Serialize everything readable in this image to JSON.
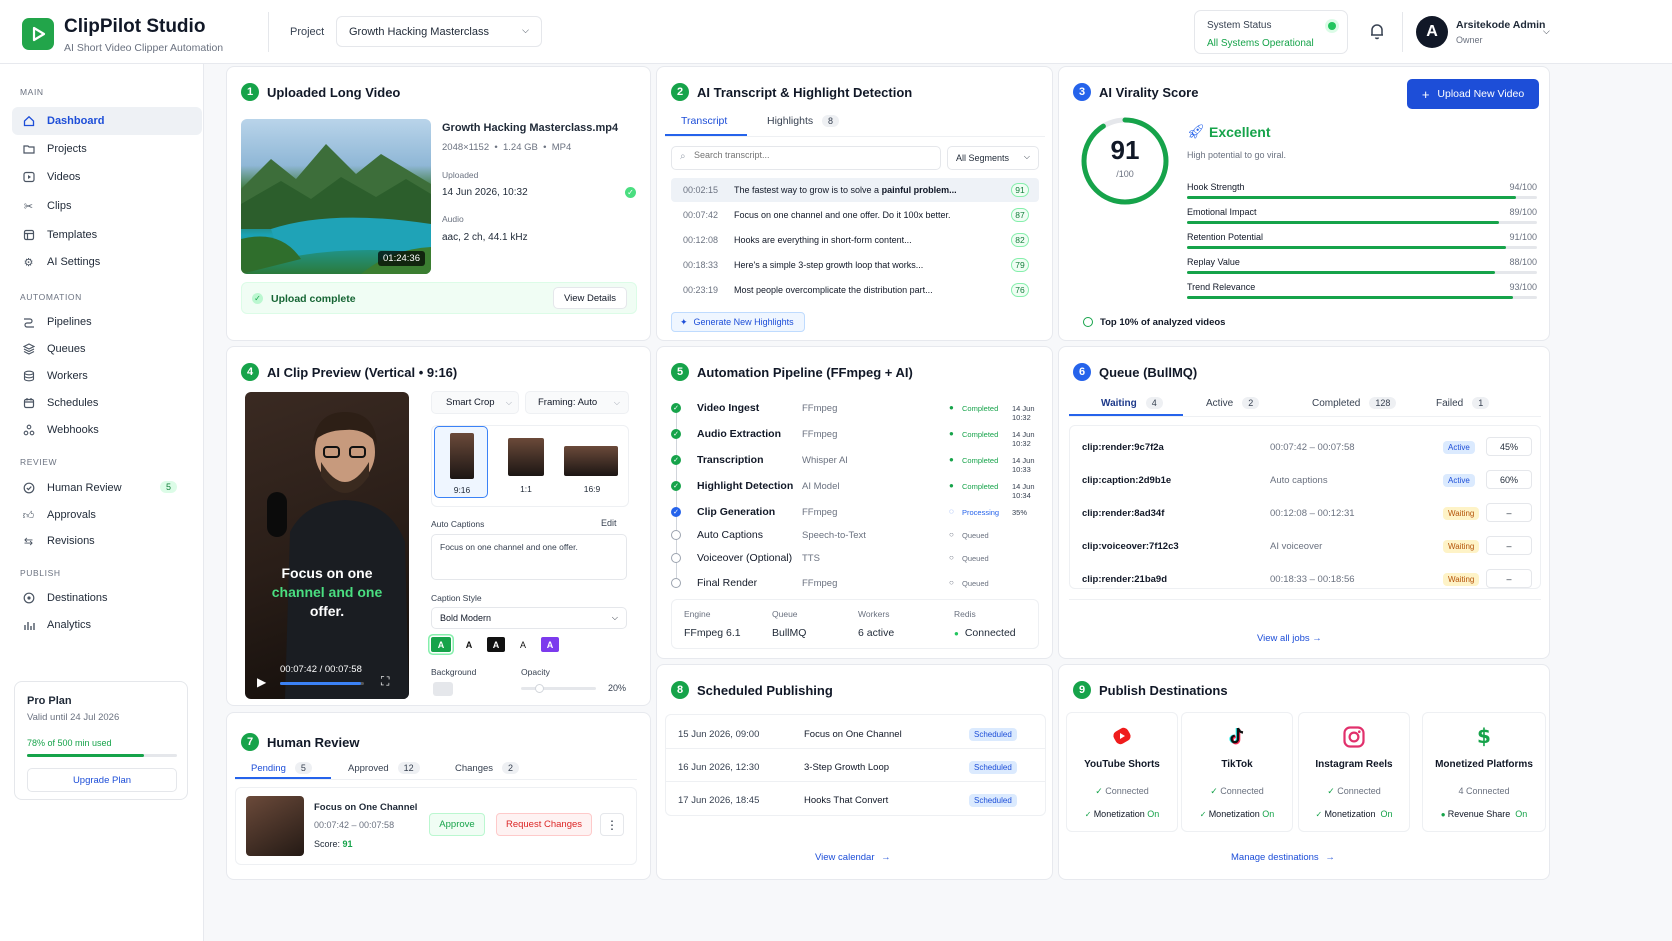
{
  "app": {
    "name": "ClipPilot Studio",
    "subtitle": "AI Short Video Clipper Automation"
  },
  "header": {
    "project_label": "Project",
    "project_value": "Growth Hacking Masterclass",
    "status_title": "System Status",
    "status_value": "All Systems Operational",
    "user_name": "Arsitekode Admin",
    "user_role": "Owner",
    "avatar_letter": "A"
  },
  "sidebar": {
    "sections": {
      "main": "MAIN",
      "automation": "AUTOMATION",
      "review": "REVIEW",
      "publish": "PUBLISH"
    },
    "main": [
      {
        "label": "Dashboard",
        "icon": "home-icon"
      },
      {
        "label": "Projects",
        "icon": "folder-icon"
      },
      {
        "label": "Videos",
        "icon": "play-square-icon"
      },
      {
        "label": "Clips",
        "icon": "scissors-icon"
      },
      {
        "label": "Templates",
        "icon": "template-icon"
      },
      {
        "label": "AI Settings",
        "icon": "gear-icon"
      }
    ],
    "automation": [
      {
        "label": "Pipelines",
        "icon": "pipeline-icon"
      },
      {
        "label": "Queues",
        "icon": "stack-icon"
      },
      {
        "label": "Workers",
        "icon": "database-icon"
      },
      {
        "label": "Schedules",
        "icon": "calendar-icon"
      },
      {
        "label": "Webhooks",
        "icon": "webhook-icon"
      }
    ],
    "review": [
      {
        "label": "Human Review",
        "icon": "check-circle-icon",
        "badge": "5"
      },
      {
        "label": "Approvals",
        "icon": "thumb-icon"
      },
      {
        "label": "Revisions",
        "icon": "revision-icon"
      }
    ],
    "publish": [
      {
        "label": "Destinations",
        "icon": "send-icon"
      },
      {
        "label": "Analytics",
        "icon": "chart-icon"
      }
    ],
    "plan": {
      "name": "Pro Plan",
      "valid": "Valid until 24 Jul 2026",
      "usage": "78% of 500 min used",
      "usage_value": 0.78,
      "upgrade": "Upgrade Plan"
    }
  },
  "upload": {
    "num": "1",
    "title": "Uploaded Long Video",
    "filename": "Growth Hacking Masterclass.mp4",
    "meta": "2048×1152  •  1.24 GB  •  MP4",
    "duration": "01:24:36",
    "uploaded_label": "Uploaded",
    "uploaded_value": "14 Jun 2026, 10:32",
    "audio_label": "Audio",
    "audio_value": "aac, 2 ch, 44.1 kHz",
    "complete": "Upload complete",
    "details": "View Details"
  },
  "transcript": {
    "num": "2",
    "title": "AI Transcript & Highlight Detection",
    "tab1": "Transcript",
    "tab2": "Highlights",
    "tab2_count": "8",
    "search_placeholder": "Search transcript...",
    "filter": "All Segments",
    "rows": [
      {
        "time": "00:02:15",
        "pre": "The fastest way to grow is to solve a ",
        "bold": "painful problem...",
        "score": "91"
      },
      {
        "time": "00:07:42",
        "pre": "Focus on one channel and one offer. Do it 100x better.",
        "bold": "",
        "score": "87"
      },
      {
        "time": "00:12:08",
        "pre": "Hooks are everything in short-form content...",
        "bold": "",
        "score": "82"
      },
      {
        "time": "00:18:33",
        "pre": "Here's a simple 3-step growth loop that works...",
        "bold": "",
        "score": "79"
      },
      {
        "time": "00:23:19",
        "pre": "Most people overcomplicate the distribution part...",
        "bold": "",
        "score": "76"
      }
    ],
    "generate": "Generate New Highlights"
  },
  "virality": {
    "num": "3",
    "title": "AI Virality Score",
    "upload_btn": "Upload New Video",
    "score": "91",
    "score_value": 91,
    "score_max": "/100",
    "rating": "Excellent",
    "rating_desc": "High potential to go viral.",
    "metrics": [
      {
        "label": "Hook Strength",
        "value": "94/100",
        "v": 94
      },
      {
        "label": "Emotional Impact",
        "value": "89/100",
        "v": 89
      },
      {
        "label": "Retention Potential",
        "value": "91/100",
        "v": 91
      },
      {
        "label": "Replay Value",
        "value": "88/100",
        "v": 88
      },
      {
        "label": "Trend Relevance",
        "value": "93/100",
        "v": 93
      }
    ],
    "footer": "Top 10% of analyzed videos"
  },
  "preview": {
    "num": "4",
    "title": "AI Clip Preview (Vertical • 9:16)",
    "caption_white1": "Focus on one",
    "caption_green": "channel and one",
    "caption_white2": "offer.",
    "time": "00:07:42 / 00:07:58",
    "progress": 0.96,
    "smart_crop": "Smart Crop",
    "framing": "Framing: Auto",
    "ratios": [
      "9:16",
      "1:1",
      "16:9"
    ],
    "auto_captions": "Auto Captions",
    "edit": "Edit",
    "caption_text": "Focus on one channel and one offer.",
    "caption_style_label": "Caption Style",
    "caption_style": "Bold Modern",
    "style_letters": [
      "A",
      "A",
      "A",
      "A",
      "A"
    ],
    "background": "Background",
    "opacity": "Opacity",
    "opacity_value": "20%"
  },
  "pipeline": {
    "num": "5",
    "title": "Automation Pipeline (FFmpeg + AI)",
    "steps": [
      {
        "name": "Video Ingest",
        "tool": "FFmpeg",
        "status": "Completed",
        "time": "14 Jun 10:32",
        "state": "done"
      },
      {
        "name": "Audio Extraction",
        "tool": "FFmpeg",
        "status": "Completed",
        "time": "14 Jun 10:32",
        "state": "done"
      },
      {
        "name": "Transcription",
        "tool": "Whisper AI",
        "status": "Completed",
        "time": "14 Jun 10:33",
        "state": "done"
      },
      {
        "name": "Highlight Detection",
        "tool": "AI Model",
        "status": "Completed",
        "time": "14 Jun 10:34",
        "state": "done"
      },
      {
        "name": "Clip Generation",
        "tool": "FFmpeg",
        "status": "Processing",
        "time": "35%",
        "state": "proc"
      },
      {
        "name": "Auto Captions",
        "tool": "Speech-to-Text",
        "status": "Queued",
        "time": "",
        "state": "queued"
      },
      {
        "name": "Voiceover (Optional)",
        "tool": "TTS",
        "status": "Queued",
        "time": "",
        "state": "queued"
      },
      {
        "name": "Final Render",
        "tool": "FFmpeg",
        "status": "Queued",
        "time": "",
        "state": "queued"
      }
    ],
    "info": [
      {
        "label": "Engine",
        "value": "FFmpeg 6.1"
      },
      {
        "label": "Queue",
        "value": "BullMQ"
      },
      {
        "label": "Workers",
        "value": "6 active"
      },
      {
        "label": "Redis",
        "value": "Connected"
      }
    ]
  },
  "queue": {
    "num": "6",
    "title": "Queue (BullMQ)",
    "tabs": [
      {
        "label": "Waiting",
        "count": "4"
      },
      {
        "label": "Active",
        "count": "2"
      },
      {
        "label": "Completed",
        "count": "128"
      },
      {
        "label": "Failed",
        "count": "1"
      }
    ],
    "jobs": [
      {
        "id": "clip:render:9c7f2a",
        "desc": "00:07:42 – 00:07:58",
        "status": "Active",
        "progress": "45%"
      },
      {
        "id": "clip:caption:2d9b1e",
        "desc": "Auto captions",
        "status": "Active",
        "progress": "60%"
      },
      {
        "id": "clip:render:8ad34f",
        "desc": "00:12:08 – 00:12:31",
        "status": "Waiting",
        "progress": "–"
      },
      {
        "id": "clip:voiceover:7f12c3",
        "desc": "AI voiceover",
        "status": "Waiting",
        "progress": "–"
      },
      {
        "id": "clip:render:21ba9d",
        "desc": "00:18:33 – 00:18:56",
        "status": "Waiting",
        "progress": "–"
      }
    ],
    "view_all": "View all jobs"
  },
  "review": {
    "num": "7",
    "title": "Human Review",
    "tabs": [
      {
        "label": "Pending",
        "count": "5"
      },
      {
        "label": "Approved",
        "count": "12"
      },
      {
        "label": "Changes",
        "count": "2"
      }
    ],
    "item_title": "Focus on One Channel",
    "item_range": "00:07:42 – 00:07:58",
    "score_label": "Score:",
    "score": "91",
    "approve": "Approve",
    "request": "Request Changes"
  },
  "scheduled": {
    "num": "8",
    "title": "Scheduled Publishing",
    "rows": [
      {
        "date": "15 Jun 2026, 09:00",
        "name": "Focus on One Channel",
        "status": "Scheduled"
      },
      {
        "date": "16 Jun 2026, 12:30",
        "name": "3-Step Growth Loop",
        "status": "Scheduled"
      },
      {
        "date": "17 Jun 2026, 18:45",
        "name": "Hooks That Convert",
        "status": "Scheduled"
      }
    ],
    "view": "View calendar"
  },
  "destinations": {
    "num": "9",
    "title": "Publish Destinations",
    "items": [
      {
        "name": "YouTube Shorts",
        "status": "Connected",
        "mon": "Monetization On",
        "icon": "youtube-icon",
        "color": "#ef1c1c"
      },
      {
        "name": "TikTok",
        "status": "Connected",
        "mon": "Monetization On",
        "icon": "tiktok-icon",
        "color": "#111111"
      },
      {
        "name": "Instagram Reels",
        "status": "Connected",
        "mon": "Monetization  On",
        "icon": "instagram-icon",
        "color": "#e1306c"
      },
      {
        "name": "Monetized Platforms",
        "status": "4 Connected",
        "mon": "Revenue Share  On",
        "icon": "dollar-icon",
        "color": "#16a34a"
      }
    ],
    "manage": "Manage destinations"
  }
}
